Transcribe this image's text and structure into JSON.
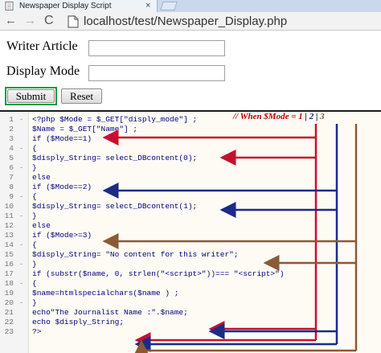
{
  "tab": {
    "title": "Newspaper Display Script",
    "close_glyph": "×"
  },
  "toolbar": {
    "back_glyph": "←",
    "forward_glyph": "→",
    "reload_glyph": "C",
    "url": "localhost/test/Newspaper_Display.php"
  },
  "form": {
    "writer_label": "Writer Article",
    "mode_label": "Display Mode",
    "writer_value": "",
    "mode_value": "",
    "submit_label": "Submit",
    "reset_label": "Reset"
  },
  "annotation": {
    "prefix": "// When $Mode = ",
    "value1": "1",
    "sep": "|",
    "value2": "2",
    "value3": "3"
  },
  "code": {
    "lines": [
      {
        "n": "1",
        "fold": "-",
        "text": "<?php  $Mode = $_GET[\"disply_mode\"] ;"
      },
      {
        "n": "2",
        "fold": "",
        "text": " $Name = $_GET[\"Name\"] ;"
      },
      {
        "n": "3",
        "fold": "",
        "text": " if ($Mode==1)"
      },
      {
        "n": "4",
        "fold": "-",
        "text": "{"
      },
      {
        "n": "5",
        "fold": "",
        "text": " $disply_String= select_DBcontent(0);"
      },
      {
        "n": "6",
        "fold": "-",
        "text": "}"
      },
      {
        "n": "7",
        "fold": "",
        "text": " else"
      },
      {
        "n": "8",
        "fold": "",
        "text": " if ($Mode==2)"
      },
      {
        "n": "9",
        "fold": "-",
        "text": "{"
      },
      {
        "n": "10",
        "fold": "",
        "text": " $disply_String= select_DBcontent(1);"
      },
      {
        "n": "11",
        "fold": "-",
        "text": "}"
      },
      {
        "n": "12",
        "fold": "",
        "text": " else"
      },
      {
        "n": "13",
        "fold": "",
        "text": " if ($Mode>=3)"
      },
      {
        "n": "14",
        "fold": "-",
        "text": "{"
      },
      {
        "n": "15",
        "fold": "",
        "text": " $disply_String= \"No content for this writer\";"
      },
      {
        "n": "16",
        "fold": "-",
        "text": "}"
      },
      {
        "n": "17",
        "fold": "",
        "text": " if (substr($name, 0, strlen(\"<script>\"))=== \"<script>\")"
      },
      {
        "n": "18",
        "fold": "-",
        "text": "{"
      },
      {
        "n": "19",
        "fold": "",
        "text": " $name=htmlspecialchars($name ) ;"
      },
      {
        "n": "20",
        "fold": "-",
        "text": "}"
      },
      {
        "n": "21",
        "fold": "",
        "text": " echo\"The Journalist Name :\".$name;"
      },
      {
        "n": "22",
        "fold": "",
        "text": " echo $disply_String;"
      },
      {
        "n": "23",
        "fold": "",
        "text": "?>"
      }
    ]
  },
  "colors": {
    "mode1": "#c8102e",
    "mode2": "#1c2b8a",
    "mode3": "#8b5a35",
    "submit_border": "#1e9b3c"
  }
}
